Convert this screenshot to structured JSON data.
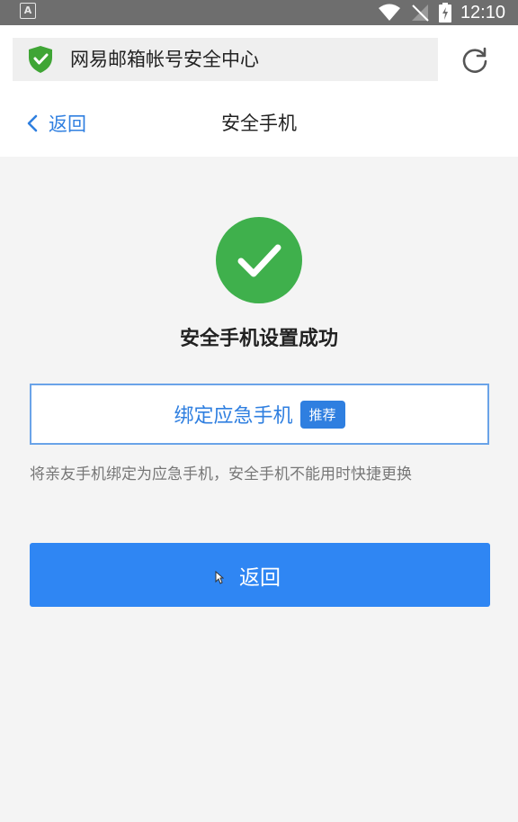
{
  "status_bar": {
    "time": "12:10",
    "notification_letter": "A"
  },
  "browser": {
    "url_title": "网易邮箱帐号安全中心"
  },
  "nav": {
    "back_label": "返回",
    "title": "安全手机"
  },
  "main": {
    "success_message": "安全手机设置成功",
    "bind_emergency": {
      "label": "绑定应急手机",
      "badge": "推荐"
    },
    "description": "将亲友手机绑定为应急手机，安全手机不能用时快捷更换",
    "return_button": "返回"
  },
  "colors": {
    "accent": "#2f86f3",
    "success": "#3fb04c",
    "link": "#2f7fe0"
  }
}
